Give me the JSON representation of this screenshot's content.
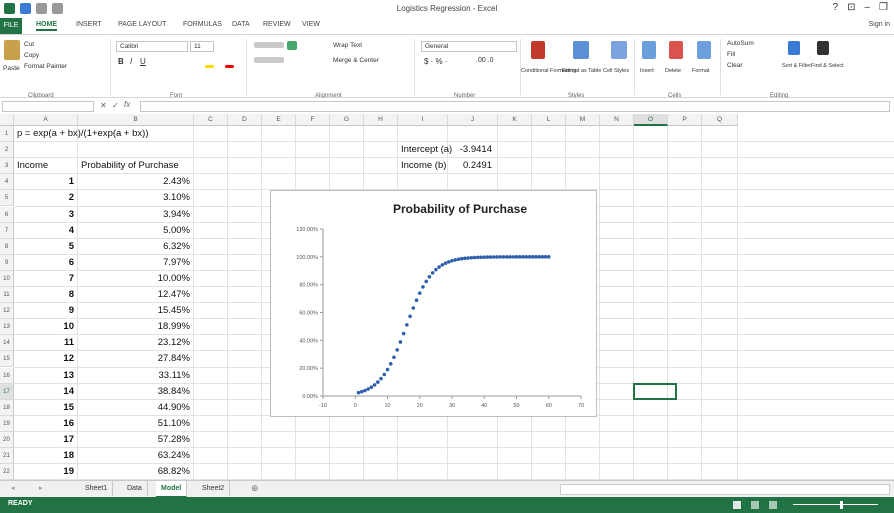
{
  "window": {
    "title": "Logistics Regression - Excel",
    "controls": [
      "?",
      "⊡",
      "–",
      "❐"
    ]
  },
  "tabs": {
    "file": "FILE",
    "items": [
      "HOME",
      "INSERT",
      "PAGE LAYOUT",
      "FORMULAS",
      "DATA",
      "REVIEW",
      "VIEW"
    ],
    "signin": "Sign in"
  },
  "ribbon": {
    "clipboard": {
      "paste": "Paste",
      "cut": "Cut",
      "copy": "Copy",
      "format_painter": "Format Painter",
      "group": "Clipboard"
    },
    "font": {
      "name": "Calibri",
      "size": "11",
      "group": "Font"
    },
    "alignment": {
      "wrap": "Wrap Text",
      "merge": "Merge & Center",
      "group": "Alignment"
    },
    "number": {
      "format": "General",
      "group": "Number"
    },
    "styles": {
      "conditional": "Conditional Formatting",
      "format_table": "Format as Table",
      "cell_styles": "Cell Styles",
      "group": "Styles"
    },
    "cells": {
      "insert": "Insert",
      "delete": "Delete",
      "format": "Format",
      "group": "Cells"
    },
    "editing": {
      "autosum": "AutoSum",
      "fill": "Fill",
      "clear": "Clear",
      "sort": "Sort & Filter",
      "find": "Find & Select",
      "group": "Editing"
    }
  },
  "formula_bar": {
    "name_box": "",
    "formula": ""
  },
  "columns": [
    "A",
    "B",
    "C",
    "D",
    "E",
    "F",
    "G",
    "H",
    "I",
    "J",
    "K",
    "L",
    "M",
    "N",
    "O",
    "P",
    "Q"
  ],
  "rows": [
    "1",
    "2",
    "3",
    "4",
    "5",
    "6",
    "7",
    "8",
    "9",
    "10",
    "11",
    "12",
    "13",
    "14",
    "15",
    "16",
    "17",
    "18",
    "19",
    "20",
    "21",
    "22"
  ],
  "sheet": {
    "formula_note": "p = exp(a + bx)/(1+exp(a + bx))",
    "header_income": "Income",
    "header_prob": "Probability of Purchase",
    "intercept_label": "Intercept (a)",
    "intercept_value": "-3.9414",
    "income_label": "Income (b)",
    "income_value": "0.2491",
    "table": [
      [
        "1",
        "2.43%"
      ],
      [
        "2",
        "3.10%"
      ],
      [
        "3",
        "3.94%"
      ],
      [
        "4",
        "5.00%"
      ],
      [
        "5",
        "6.32%"
      ],
      [
        "6",
        "7.97%"
      ],
      [
        "7",
        "10.00%"
      ],
      [
        "8",
        "12.47%"
      ],
      [
        "9",
        "15.45%"
      ],
      [
        "10",
        "18.99%"
      ],
      [
        "11",
        "23.12%"
      ],
      [
        "12",
        "27.84%"
      ],
      [
        "13",
        "33.11%"
      ],
      [
        "14",
        "38.84%"
      ],
      [
        "15",
        "44.90%"
      ],
      [
        "16",
        "51.10%"
      ],
      [
        "17",
        "57.28%"
      ],
      [
        "18",
        "63.24%"
      ],
      [
        "19",
        "68.82%"
      ]
    ]
  },
  "chart_data": {
    "type": "scatter",
    "title": "Probability of Purchase",
    "xlabel": "",
    "ylabel": "",
    "xlim": [
      -10,
      70
    ],
    "ylim": [
      0,
      120
    ],
    "xticks": [
      "-10",
      "0",
      "10",
      "20",
      "30",
      "40",
      "50",
      "60",
      "70"
    ],
    "yticks": [
      "0.00%",
      "20.00%",
      "40.00%",
      "60.00%",
      "80.00%",
      "100.00%",
      "120.00%"
    ],
    "model": {
      "a": -3.9414,
      "b": 0.2491,
      "x_from": 1,
      "x_to": 60
    },
    "color": "#2e5fae",
    "grid": false,
    "legend": "none"
  },
  "sheet_tabs": [
    "Sheet1",
    "Data",
    "Model",
    "Sheet2"
  ],
  "active_tab": "Model",
  "status": {
    "ready": "READY"
  }
}
